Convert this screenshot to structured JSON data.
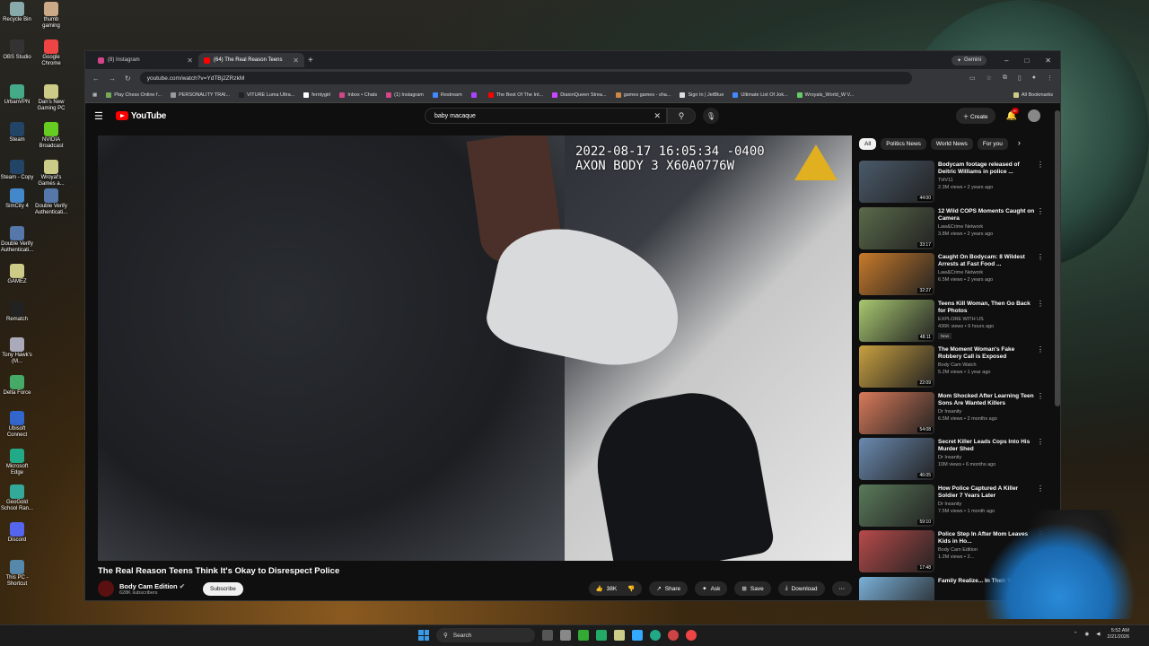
{
  "desktop_icons": [
    {
      "label": "Recycle Bin",
      "color": "#8aa"
    },
    {
      "label": "thumb gaming",
      "color": "#ca8"
    },
    {
      "label": "OBS Studio",
      "color": "#333"
    },
    {
      "label": "Google Chrome",
      "color": "#e44"
    },
    {
      "label": "UrbanVPN",
      "color": "#4a8"
    },
    {
      "label": "Dan's New Gaming PC",
      "color": "#cc8"
    },
    {
      "label": "Steam",
      "color": "#246"
    },
    {
      "label": "NVIDIA Broadcast",
      "color": "#6c2"
    },
    {
      "label": "Steam - Copy",
      "color": "#246"
    },
    {
      "label": "Wroyal's Games a...",
      "color": "#cc8"
    },
    {
      "label": "SimCity 4",
      "color": "#48c"
    },
    {
      "label": "Double Verify Authenticati...",
      "color": "#57a"
    },
    {
      "label": "Double Verify Authenticati...",
      "color": "#57a"
    },
    {
      "label": "GAMEZ",
      "color": "#cc8"
    },
    {
      "label": "Rematch",
      "color": "#222"
    },
    {
      "label": "Tony Hawk's (M...",
      "color": "#aab"
    },
    {
      "label": "Delta Force",
      "color": "#4a6"
    },
    {
      "label": "Ubisoft Connect",
      "color": "#36c"
    },
    {
      "label": "Microsoft Edge",
      "color": "#2a8"
    },
    {
      "label": "GeoGold School Ran...",
      "color": "#3a9"
    },
    {
      "label": "Discord",
      "color": "#56e"
    },
    {
      "label": "This PC - Shortcut",
      "color": "#58a"
    }
  ],
  "tabs": [
    {
      "label": "(8) Instagram",
      "color": "#d4458a",
      "active": false
    },
    {
      "label": "(64) The Real Reason Teens",
      "color": "#f00",
      "active": true
    }
  ],
  "gemini_label": "Gemini",
  "window_controls": {
    "min": "–",
    "max": "□",
    "close": "✕"
  },
  "url": "youtube.com/watch?v=YdTBj2ZRzkM",
  "bookmarks": [
    {
      "label": "Play Chess Online f...",
      "color": "#7a5"
    },
    {
      "label": "PERSONALITY TRAI...",
      "color": "#999"
    },
    {
      "label": "VITURE Luma Ultra...",
      "color": "#222"
    },
    {
      "label": "ferntygirl",
      "color": "#fff"
    },
    {
      "label": "Inbox • Chats",
      "color": "#d4458a"
    },
    {
      "label": "(1) Instagram",
      "color": "#d4458a"
    },
    {
      "label": "Restream",
      "color": "#48f"
    },
    {
      "label": "",
      "color": "#a4f"
    },
    {
      "label": "The Best Of The Int...",
      "color": "#f00"
    },
    {
      "label": "DiaionQueen Strea...",
      "color": "#c4f"
    },
    {
      "label": "games games - sha...",
      "color": "#c84"
    },
    {
      "label": "Sign In | JetBlue",
      "color": "#ddd"
    },
    {
      "label": "Ultimate List Of Jok...",
      "color": "#48f"
    },
    {
      "label": "Wroyals_World_W V...",
      "color": "#6c6"
    },
    {
      "label": "All Bookmarks",
      "color": "#cc8"
    }
  ],
  "search_query": "baby macaque",
  "create_label": "Create",
  "notif_count": "9+",
  "logo_text": "YouTube",
  "video": {
    "timestamp": "2022-08-17 16:05:34 -0400\nAXON BODY 3 X60A0776W",
    "title": "The Real Reason Teens Think It's Okay to Disrespect Police",
    "channel": "Body Cam Edition",
    "subs": "628K subscribers",
    "subscribe": "Subscribe",
    "likes": "38K",
    "share": "Share",
    "ask": "Ask",
    "save": "Save",
    "download": "Download"
  },
  "chips": [
    "All",
    "Politics News",
    "World News",
    "For you"
  ],
  "recs": [
    {
      "title": "Bodycam footage released of Deitric Williams in police ...",
      "channel": "THV11",
      "meta": "2.3M views • 2 years ago",
      "dur": "44:00",
      "thumb": "#4a5a6a"
    },
    {
      "title": "12 Wild COPS Moments Caught on Camera",
      "channel": "Law&Crime Network",
      "meta": "3.8M views • 2 years ago",
      "dur": "33:17",
      "thumb": "#5a6a4a"
    },
    {
      "title": "Caught On Bodycam: 8 Wildest Arrests at Fast Food ...",
      "channel": "Law&Crime Network",
      "meta": "6.5M views • 2 years ago",
      "dur": "32:27",
      "thumb": "#c87a2a"
    },
    {
      "title": "Teens Kill Woman, Then Go Back for Photos",
      "channel": "EXPLORE WITH US",
      "meta": "436K views • 9 hours ago",
      "dur": "48:11",
      "thumb": "#a8c870",
      "new": "New"
    },
    {
      "title": "The Moment Woman's Fake Robbery Call is Exposed",
      "channel": "Body Cam Watch",
      "meta": "5.2M views • 1 year ago",
      "dur": "22:09",
      "thumb": "#c8a040"
    },
    {
      "title": "Mom Shocked After Learning Teen Sons Are Wanted Killers",
      "channel": "Dr Insanity",
      "meta": "6.5M views • 2 months ago",
      "dur": "54:08",
      "thumb": "#d87a5a"
    },
    {
      "title": "Secret Killer Leads Cops Into His Murder Shed",
      "channel": "Dr Insanity",
      "meta": "10M views • 6 months ago",
      "dur": "46:05",
      "thumb": "#6a8ab0"
    },
    {
      "title": "How Police Captured A Killer Soldier 7 Years Later",
      "channel": "Dr Insanity",
      "meta": "7.5M views • 1 month ago",
      "dur": "59:10",
      "thumb": "#5a7a5a"
    },
    {
      "title": "Police Step In After Mom Leaves Kids in Ho...",
      "channel": "Body Cam Edition",
      "meta": "1.2M views • 2...",
      "dur": "17:48",
      "thumb": "#b84a4a"
    },
    {
      "title": "Family Realize... In Their Vent...",
      "channel": "",
      "meta": "",
      "dur": "",
      "thumb": "#7ab0d8"
    }
  ],
  "taskbar": {
    "search": "Search",
    "time": "5:52 AM",
    "date": "2/21/2026"
  }
}
